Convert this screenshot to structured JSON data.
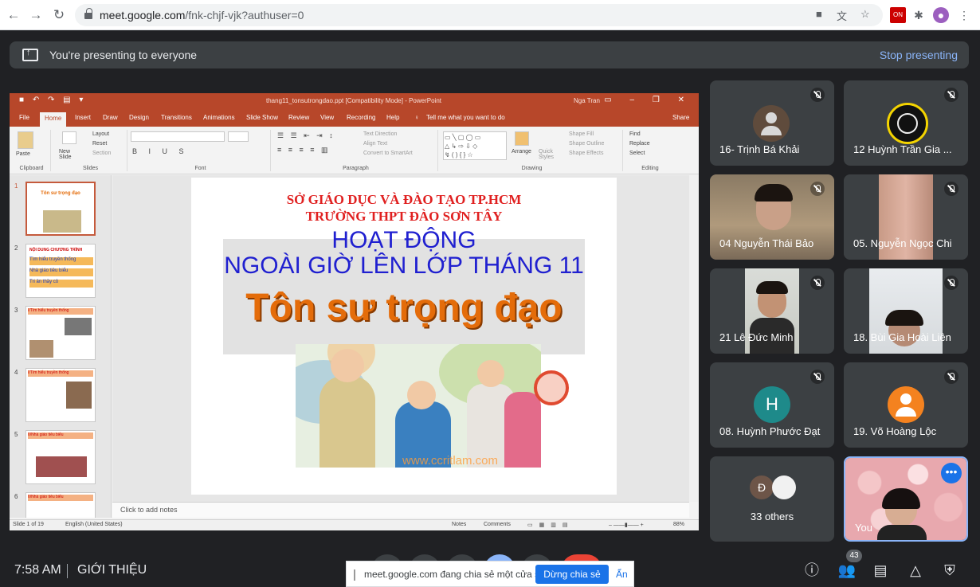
{
  "browser": {
    "url_host": "meet.google.com",
    "url_path": "/fnk-chjf-vjk?authuser=0"
  },
  "banner": {
    "text": "You're presenting to everyone",
    "stop_label": "Stop presenting"
  },
  "ppt": {
    "doc_title": "thang11_tonsutrongdao.ppt [Compatibility Mode] - PowerPoint",
    "user": "Nga Tran",
    "tabs": [
      "File",
      "Home",
      "Insert",
      "Draw",
      "Design",
      "Transitions",
      "Animations",
      "Slide Show",
      "Review",
      "View",
      "Recording",
      "Help"
    ],
    "tell_me": "Tell me what you want to do",
    "share": "Share",
    "groups": {
      "clipboard": "Clipboard",
      "slides": "Slides",
      "font": "Font",
      "paragraph": "Paragraph",
      "drawing": "Drawing",
      "editing": "Editing"
    },
    "ribbon_items": {
      "paste": "Paste",
      "new_slide": "New Slide",
      "layout": "Layout",
      "reset": "Reset",
      "section": "Section",
      "text_direction": "Text Direction",
      "align_text": "Align Text",
      "convert_smartart": "Convert to SmartArt",
      "arrange": "Arrange",
      "quick_styles": "Quick Styles",
      "shape_fill": "Shape Fill",
      "shape_outline": "Shape Outline",
      "shape_effects": "Shape Effects",
      "find": "Find",
      "replace": "Replace",
      "select": "Select"
    },
    "slide": {
      "line1": "SỞ GIÁO DỤC VÀ ĐÀO TẠO TP.HCM",
      "line2": "TRƯỜNG THPT ĐÀO SƠN TÂY",
      "line3": "HOẠT ĐỘNG",
      "line4": "NGOÀI GIỜ LÊN LỚP THÁNG 11",
      "line5": "Tôn sư trọng đạo",
      "watermark": "www.ccritlam.com"
    },
    "thumbs": {
      "t1_title": "Tôn sư trọng đạo",
      "t2_title": "NỘI DUNG CHƯƠNG TRÌNH",
      "t2_items": [
        "Tìm hiểu truyền thống",
        "Nhà giáo tiêu biểu",
        "Tri ân thầy cô"
      ],
      "t3_title": "I/Tìm hiểu truyền thống",
      "t4_title": "I/Tìm hiểu truyền thống",
      "t5_title": "II/Nhà giáo tiêu biểu",
      "t6_title": "II/Nhà giáo tiêu biểu"
    },
    "thumb_numbers": [
      "1",
      "2",
      "3",
      "4",
      "5",
      "6"
    ],
    "notes_placeholder": "Click to add notes",
    "status": {
      "slide_count": "Slide 1 of 19",
      "language": "English (United States)",
      "notes": "Notes",
      "comments": "Comments",
      "zoom": "88%"
    }
  },
  "participants": [
    {
      "name": "16- Trịnh Bá Khải",
      "type": "avatar",
      "color": "#5f4b3c"
    },
    {
      "name": "12 Huỳnh Trần Gia ...",
      "type": "logo",
      "color": "#f4d400"
    },
    {
      "name": "04 Nguyễn Thái Bảo",
      "type": "video"
    },
    {
      "name": "05. Nguyễn Ngọc Chi",
      "type": "video"
    },
    {
      "name": "21 Lê Đức Minh",
      "type": "video"
    },
    {
      "name": "18. Bùi Gia Hoài Liên",
      "type": "video"
    },
    {
      "name": "08. Huỳnh Phước Đạt",
      "type": "initial",
      "initial": "H",
      "color": "#1e8a8a"
    },
    {
      "name": "19. Võ Hoàng Lộc",
      "type": "avatar",
      "color": "#f4821f"
    },
    {
      "name": "33 others",
      "type": "others",
      "initial": "Đ"
    },
    {
      "name": "You",
      "type": "self"
    }
  ],
  "bottom": {
    "time": "7:58 AM",
    "meeting": "GIỚI THIỆU",
    "share_msg": "meet.google.com đang chia sẻ một cửa sổ.",
    "stop_share": "Dừng chia sẻ",
    "hide": "Ẩn",
    "people_count": "43"
  }
}
